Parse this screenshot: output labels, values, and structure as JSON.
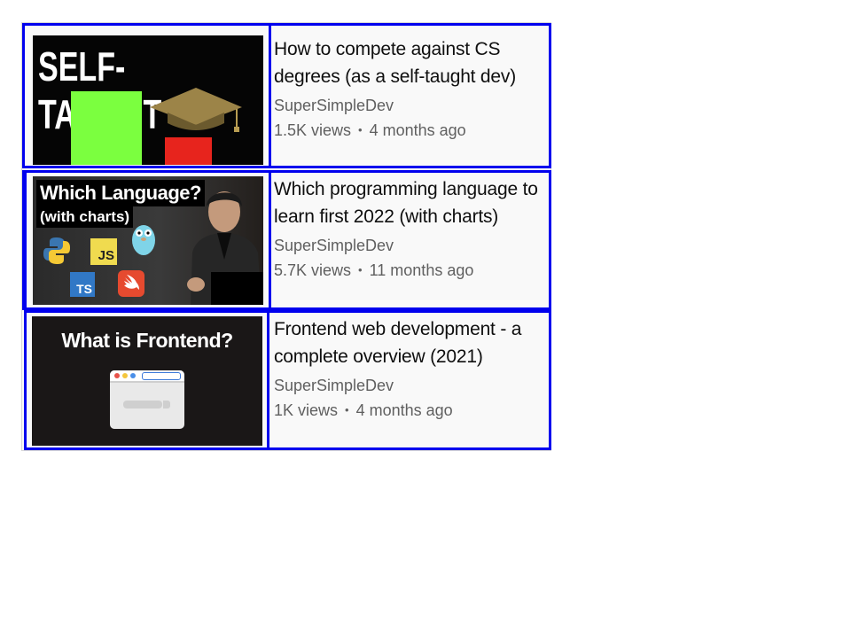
{
  "videos": [
    {
      "title": "How to compete against CS degrees (as a self-taught dev)",
      "channel": "SuperSimpleDev",
      "views": "1.5K views",
      "age": "4 months ago",
      "thumbnail_text": "SELF-TAUGHT"
    },
    {
      "title": "Which programming language to learn first 2022 (with charts)",
      "channel": "SuperSimpleDev",
      "views": "5.7K views",
      "age": "11 months ago",
      "thumbnail_text": "Which Language?",
      "thumbnail_subtext": "(with charts)",
      "badges": {
        "js": "JS",
        "ts": "TS"
      }
    },
    {
      "title": "Frontend web development - a complete overview (2021)",
      "channel": "SuperSimpleDev",
      "views": "1K views",
      "age": "4 months ago",
      "thumbnail_text": "What is Frontend?"
    }
  ],
  "separator": "•",
  "colors": {
    "highlight_border": "#0000ee",
    "panel_bg": "#f9f9f9",
    "title_text": "#0f0f0f",
    "meta_text": "#606060"
  }
}
